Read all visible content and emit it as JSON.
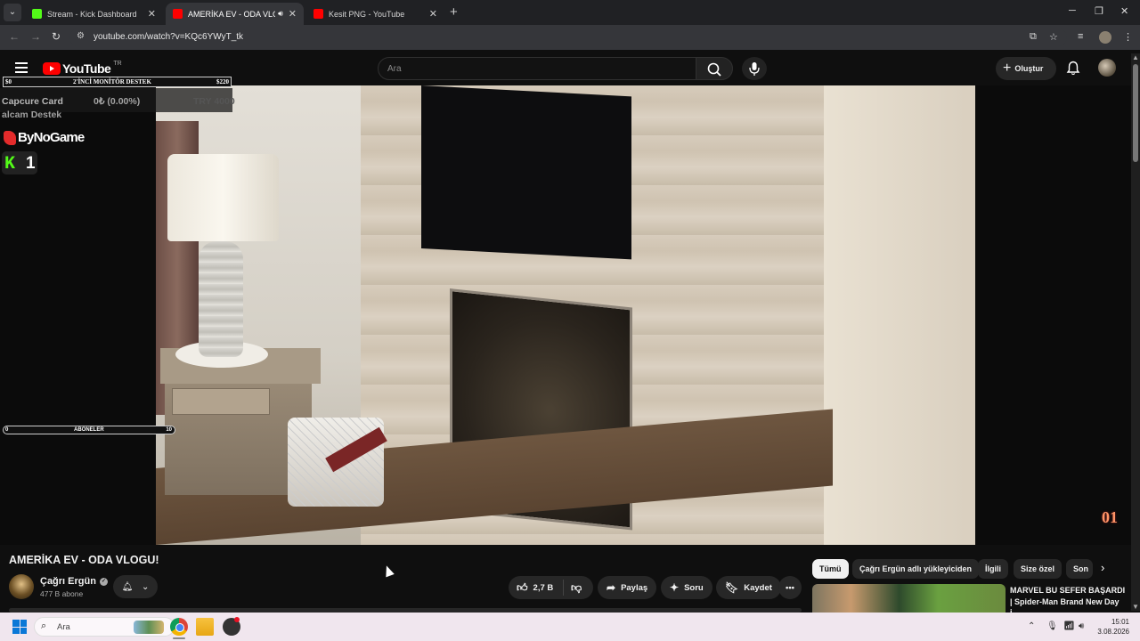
{
  "browser": {
    "tabs": [
      {
        "title": "Stream - Kick Dashboard",
        "active": false,
        "favicon_color": "#53fc18"
      },
      {
        "title": "AMERİKA EV - ODA VLOGU",
        "active": true,
        "favicon_color": "#ff0000"
      },
      {
        "title": "Kesit PNG - YouTube",
        "active": false,
        "favicon_color": "#ff0000"
      }
    ],
    "url": "youtube.com/watch?v=KQc6YWyT_tk"
  },
  "youtube": {
    "logo_text": "YouTube",
    "country": "TR",
    "search_placeholder": "Ara",
    "create_label": "Oluştur"
  },
  "overlay": {
    "goal_left": "$0",
    "goal_title": "2'İNCİ MONİTÖR DESTEK",
    "goal_right": "$220",
    "capture_label": "Capcure Card",
    "capture_amount": "0₺ (0.00%)",
    "capture_target": "TRY 4000",
    "capture_sub": "alcam Destek",
    "sponsor": "ByNoGame",
    "kick_count": "1",
    "abone_left": "0",
    "abone_title": "ABONELER",
    "abone_right": "10"
  },
  "video": {
    "title": "AMERİKA EV - ODA VLOGU!",
    "channel": "Çağrı Ergün",
    "subscribers": "477 B abone",
    "likes": "2,7 B",
    "share_label": "Paylaş",
    "ask_label": "Soru",
    "save_label": "Kaydet",
    "watermark": "01"
  },
  "chips": [
    "Tümü",
    "Çağrı Ergün adlı yükleyiciden",
    "İlgili",
    "Size özel",
    "Son"
  ],
  "recommendation": {
    "title": "MARVEL BU SEFER BAŞARDI | Spider-Man Brand New Day İ..."
  },
  "taskbar": {
    "search_placeholder": "Ara",
    "time": "15:01",
    "date": "3.08.2026"
  }
}
